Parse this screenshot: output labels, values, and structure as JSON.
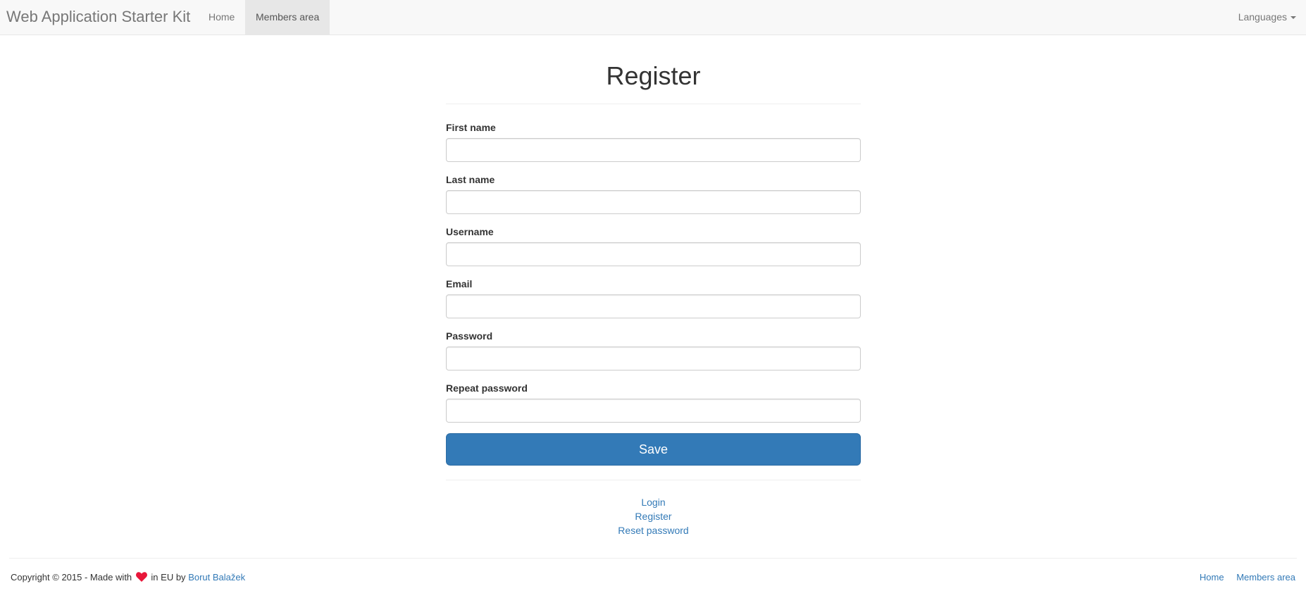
{
  "navbar": {
    "brand": "Web Application Starter Kit",
    "links": [
      {
        "label": "Home"
      },
      {
        "label": "Members area"
      }
    ],
    "languages_label": "Languages"
  },
  "page": {
    "title": "Register"
  },
  "form": {
    "fields": [
      {
        "label": "First name",
        "value": "",
        "placeholder": ""
      },
      {
        "label": "Last name",
        "value": "",
        "placeholder": ""
      },
      {
        "label": "Username",
        "value": "",
        "placeholder": ""
      },
      {
        "label": "Email",
        "value": "",
        "placeholder": ""
      },
      {
        "label": "Password",
        "value": "",
        "placeholder": ""
      },
      {
        "label": "Repeat password",
        "value": "",
        "placeholder": ""
      }
    ],
    "save_label": "Save"
  },
  "links": {
    "login": "Login",
    "register": "Register",
    "reset_password": "Reset password"
  },
  "footer": {
    "copyright_prefix": "Copyright © 2015 - Made with",
    "copyright_suffix": "in EU by",
    "author": "Borut Balažek",
    "heart_icon": "heart-icon",
    "links": [
      {
        "label": "Home"
      },
      {
        "label": "Members area"
      }
    ]
  },
  "colors": {
    "primary": "#337ab7",
    "heart": "#e8173a",
    "navbar_bg": "#f8f8f8"
  }
}
